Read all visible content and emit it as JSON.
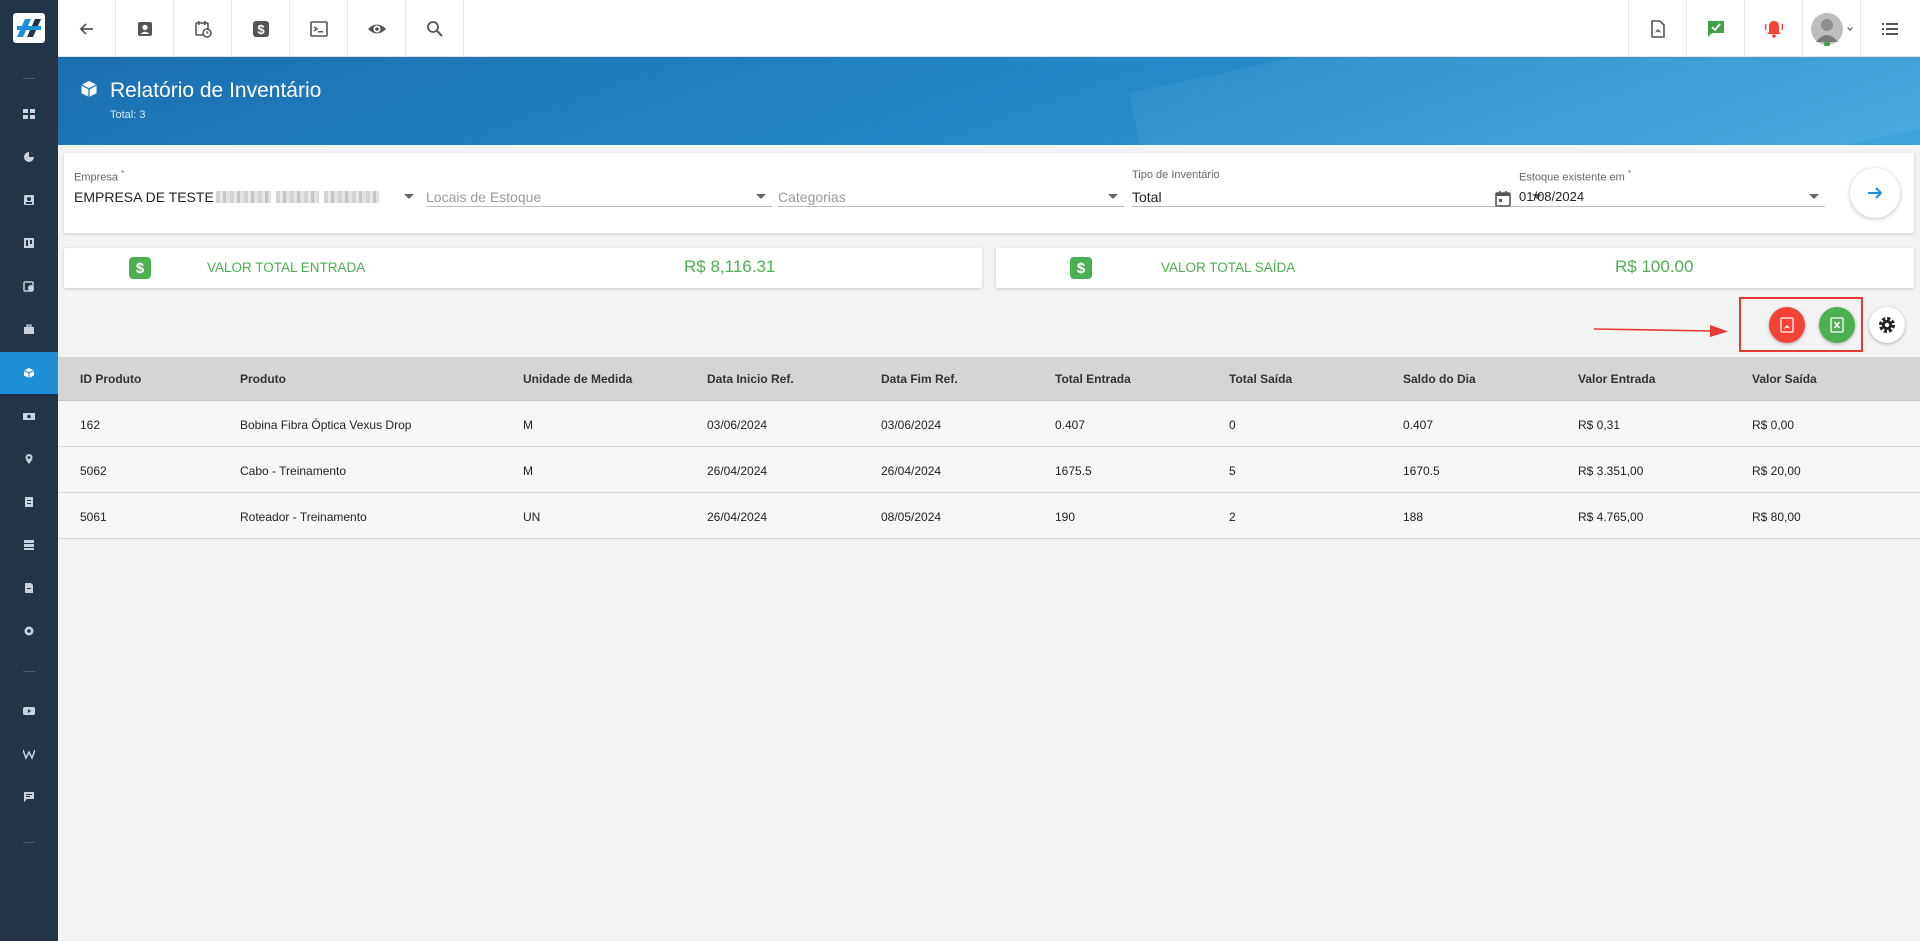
{
  "header": {
    "title": "Relatório de Inventário",
    "subtitle": "Total: 3"
  },
  "filters": {
    "empresa_label": "Empresa",
    "empresa_required": "*",
    "empresa_value": "EMPRESA DE TESTE",
    "locais_placeholder": "Locais de Estoque",
    "categorias_placeholder": "Categorias",
    "tipo_label": "Tipo de Inventário",
    "tipo_value": "Total",
    "estoque_label": "Estoque existente em",
    "estoque_required": "*",
    "estoque_value": "01/08/2024"
  },
  "totals": {
    "entrada_label": "VALOR TOTAL ENTRADA",
    "entrada_value": "R$ 8,116.31",
    "saida_label": "VALOR TOTAL SAÍDA",
    "saida_value": "R$ 100.00",
    "icon_symbol": "$"
  },
  "table": {
    "columns": [
      "ID Produto",
      "Produto",
      "Unidade de Medida",
      "Data Inicio Ref.",
      "Data Fim Ref.",
      "Total Entrada",
      "Total Saída",
      "Saldo do Dia",
      "Valor Entrada",
      "Valor Saída"
    ],
    "rows": [
      [
        "162",
        "Bobina Fibra Óptica Vexus Drop",
        "M",
        "03/06/2024",
        "03/06/2024",
        "0.407",
        "0",
        "0.407",
        "R$ 0,31",
        "R$ 0,00"
      ],
      [
        "5062",
        "Cabo - Treinamento",
        "M",
        "26/04/2024",
        "26/04/2024",
        "1675.5",
        "5",
        "1670.5",
        "R$ 3.351,00",
        "R$ 20,00"
      ],
      [
        "5061",
        "Roteador - Treinamento",
        "UN",
        "26/04/2024",
        "08/05/2024",
        "190",
        "2",
        "188",
        "R$ 4.765,00",
        "R$ 80,00"
      ]
    ]
  },
  "colors": {
    "accent": "#1e8ed6",
    "sidebar": "#243447",
    "success": "#4caf50",
    "danger": "#f44336"
  }
}
